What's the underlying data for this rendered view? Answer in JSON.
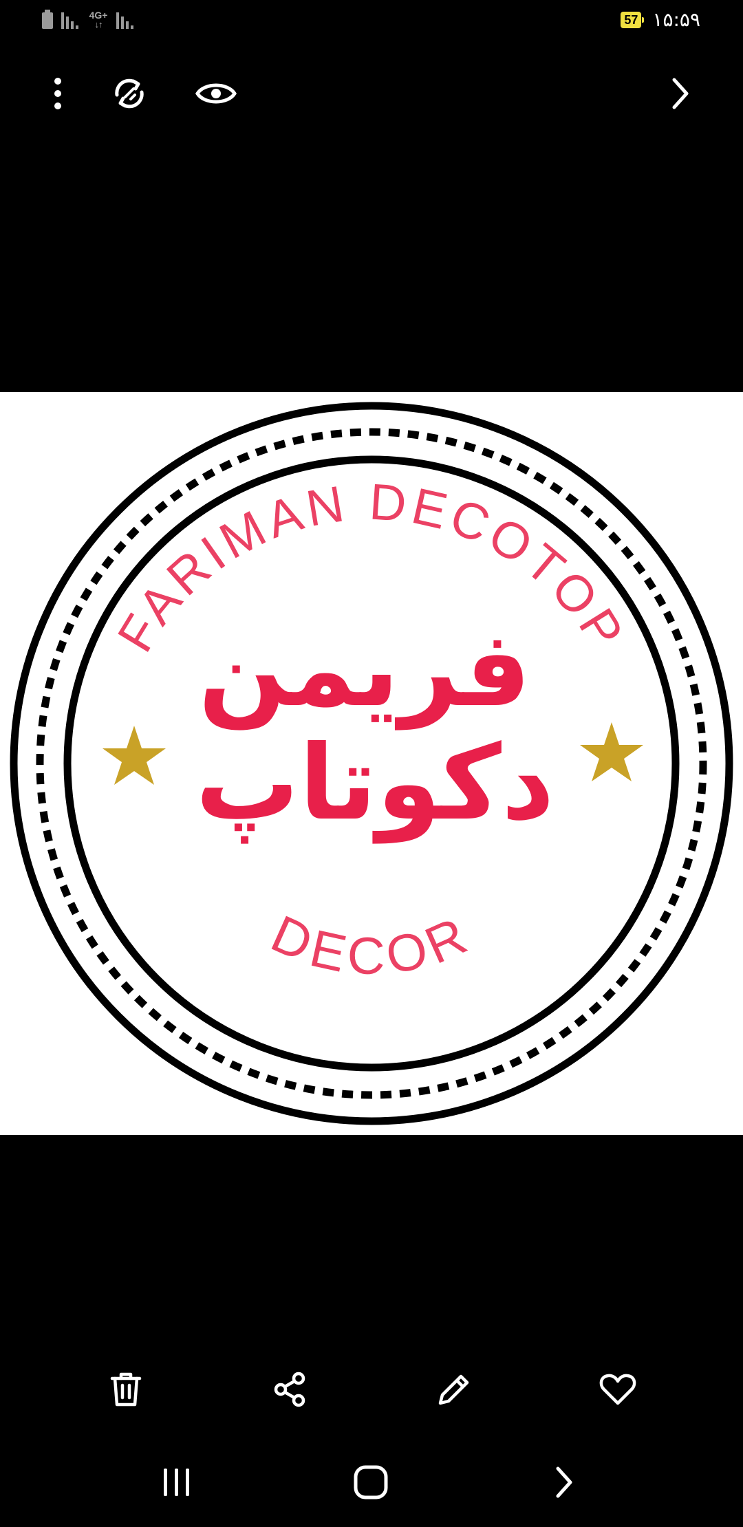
{
  "status_bar": {
    "network_type": "4G+",
    "battery_level": "57",
    "time": "۱۵:۵۹"
  },
  "toolbar": {
    "more_icon": "more-vertical-icon",
    "remaster_icon": "remaster-icon",
    "view_icon": "eye-icon",
    "next_icon": "chevron-right-icon"
  },
  "image": {
    "top_arc_text": "FARIMAN DECOTOP",
    "bottom_arc_text": "DECOR",
    "center_line_1": "فریمن",
    "center_line_2": "دکوتاپ",
    "brand_color": "#e8204a",
    "star_color": "#c9a227",
    "ring_color": "#000000"
  },
  "action_bar": {
    "delete_icon": "trash-icon",
    "share_icon": "share-icon",
    "edit_icon": "pencil-icon",
    "favorite_icon": "heart-icon"
  },
  "nav_bar": {
    "recents_icon": "recents-icon",
    "home_icon": "home-icon",
    "back_icon": "back-icon"
  }
}
